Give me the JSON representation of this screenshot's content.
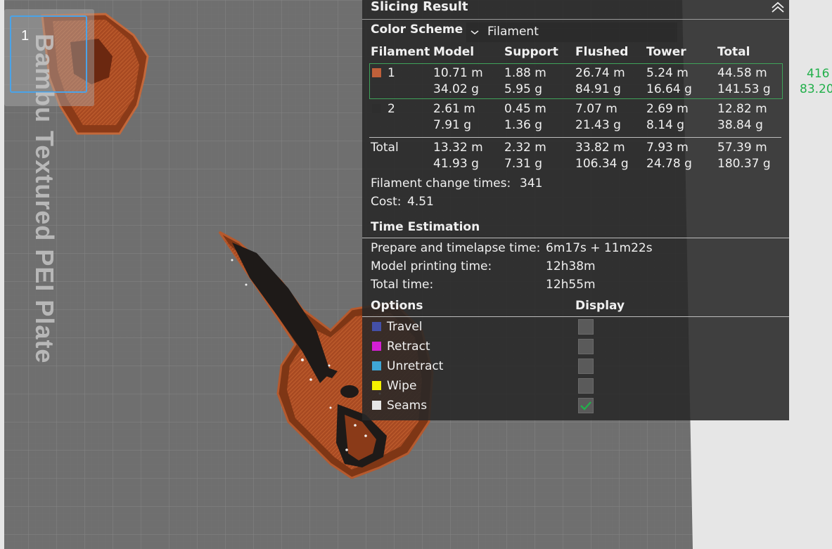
{
  "plate": {
    "label": "Bambu Textured PEI Plate",
    "thumbnail_number": "1"
  },
  "panel": {
    "title": "Slicing Result",
    "color_scheme_label": "Color Scheme",
    "color_scheme_value": "Filament",
    "headers": [
      "Filament",
      "Model",
      "Support",
      "Flushed",
      "Tower",
      "Total"
    ],
    "filaments": [
      {
        "id": "1",
        "color": "#c0603a",
        "model": [
          "10.71 m",
          "34.02 g"
        ],
        "support": [
          "1.88 m",
          "5.95 g"
        ],
        "flushed": [
          "26.74 m",
          "84.91 g"
        ],
        "tower": [
          "5.24 m",
          "16.64 g"
        ],
        "total": [
          "44.58 m",
          "141.53 g"
        ]
      },
      {
        "id": "2",
        "color": "#2e2e2e",
        "model": [
          "2.61 m",
          "7.91 g"
        ],
        "support": [
          "0.45 m",
          "1.36 g"
        ],
        "flushed": [
          "7.07 m",
          "21.43 g"
        ],
        "tower": [
          "2.69 m",
          "8.14 g"
        ],
        "total": [
          "12.82 m",
          "38.84 g"
        ]
      }
    ],
    "total_row": {
      "label": "Total",
      "model": [
        "13.32 m",
        "41.93 g"
      ],
      "support": [
        "2.32 m",
        "7.31 g"
      ],
      "flushed": [
        "33.82 m",
        "106.34 g"
      ],
      "tower": [
        "7.93 m",
        "24.78 g"
      ],
      "total": [
        "57.39 m",
        "180.37 g"
      ]
    },
    "filament_change_label": "Filament change times:",
    "filament_change_value": "341",
    "cost_label": "Cost:",
    "cost_value": "4.51",
    "time_title": "Time Estimation",
    "times": [
      {
        "label": "Prepare and timelapse time:",
        "value": "6m17s + 11m22s"
      },
      {
        "label": "Model printing time:",
        "value": "12h38m"
      },
      {
        "label": "Total time:",
        "value": "12h55m"
      }
    ],
    "options_title": "Options",
    "display_title": "Display",
    "options": [
      {
        "label": "Travel",
        "color": "#4450a8",
        "checked": false
      },
      {
        "label": "Retract",
        "color": "#d41fd4",
        "checked": false
      },
      {
        "label": "Unretract",
        "color": "#3fa6d6",
        "checked": false
      },
      {
        "label": "Wipe",
        "color": "#f5f000",
        "checked": false
      },
      {
        "label": "Seams",
        "color": "#e6e6e6",
        "checked": true
      }
    ]
  },
  "side_numbers": [
    "416",
    "83.20"
  ]
}
